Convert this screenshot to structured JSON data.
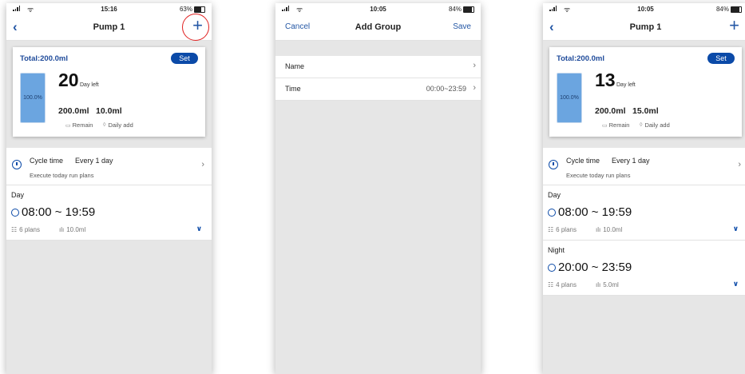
{
  "screens": [
    {
      "status": {
        "time": "15:16",
        "battery": "63%",
        "battery_level": 0.63
      },
      "nav": {
        "title": "Pump 1"
      },
      "card": {
        "total": "Total:200.0ml",
        "set_label": "Set",
        "tank_percent": "100.0%",
        "days": "20",
        "days_label": "Day left",
        "remain_value": "200.0ml",
        "daily_value": "10.0ml",
        "remain_label": "Remain",
        "daily_label": "Daily add"
      },
      "cycle": {
        "title": "Cycle time",
        "value": "Every 1 day",
        "subtitle": "Execute today run plans"
      },
      "groups": [
        {
          "name": "Day",
          "time": "08:00 ~ 19:59",
          "plans": "6 plans",
          "amount": "10.0ml"
        }
      ]
    },
    {
      "status": {
        "time": "10:05",
        "battery": "84%",
        "battery_level": 0.84
      },
      "nav": {
        "title": "Add Group",
        "cancel_label": "Cancel",
        "save_label": "Save"
      },
      "form": [
        {
          "label": "Name",
          "value": ""
        },
        {
          "label": "Time",
          "value": "00:00~23:59"
        }
      ]
    },
    {
      "status": {
        "time": "10:05",
        "battery": "84%",
        "battery_level": 0.84
      },
      "nav": {
        "title": "Pump 1"
      },
      "card": {
        "total": "Total:200.0ml",
        "set_label": "Set",
        "tank_percent": "100.0%",
        "days": "13",
        "days_label": "Day left",
        "remain_value": "200.0ml",
        "daily_value": "15.0ml",
        "remain_label": "Remain",
        "daily_label": "Daily add"
      },
      "cycle": {
        "title": "Cycle time",
        "value": "Every 1 day",
        "subtitle": "Execute today run plans"
      },
      "groups": [
        {
          "name": "Day",
          "time": "08:00 ~ 19:59",
          "plans": "6 plans",
          "amount": "10.0ml"
        },
        {
          "name": "Night",
          "time": "20:00 ~ 23:59",
          "plans": "4 plans",
          "amount": "5.0ml"
        }
      ]
    }
  ],
  "icons": {
    "back": "chevron-left-icon",
    "add": "plus-icon",
    "cycle": "timer-icon",
    "clock": "clock-icon",
    "plans": "list-icon",
    "amount": "bar-chart-icon",
    "expand": "chevron-down-icon",
    "row_arrow": "chevron-right-icon",
    "remain": "tank-icon",
    "daily": "drop-icon"
  },
  "colors": {
    "accent": "#0b4aa8",
    "nav_accent": "#2457a5",
    "tank_fill": "#6ba5e0",
    "highlight_ring": "#e02020"
  }
}
